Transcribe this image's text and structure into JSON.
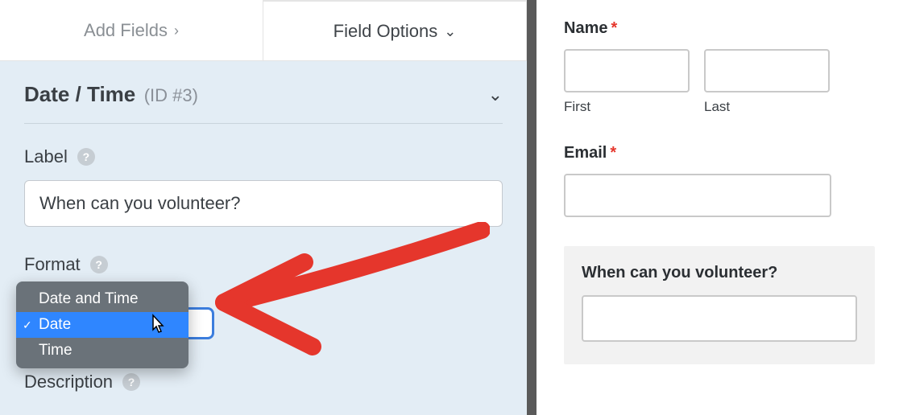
{
  "tabs": {
    "add_fields": "Add Fields",
    "field_options": "Field Options"
  },
  "section": {
    "title": "Date / Time",
    "id_text": "(ID #3)"
  },
  "label_field": {
    "label": "Label",
    "value": "When can you volunteer?"
  },
  "format_field": {
    "label": "Format",
    "options": [
      "Date and Time",
      "Date",
      "Time"
    ],
    "selected": "Date"
  },
  "description_field": {
    "label": "Description"
  },
  "preview": {
    "name": {
      "label": "Name",
      "first": "First",
      "last": "Last"
    },
    "email": {
      "label": "Email"
    },
    "volunteer": {
      "label": "When can you volunteer?"
    }
  },
  "required_marker": "*"
}
